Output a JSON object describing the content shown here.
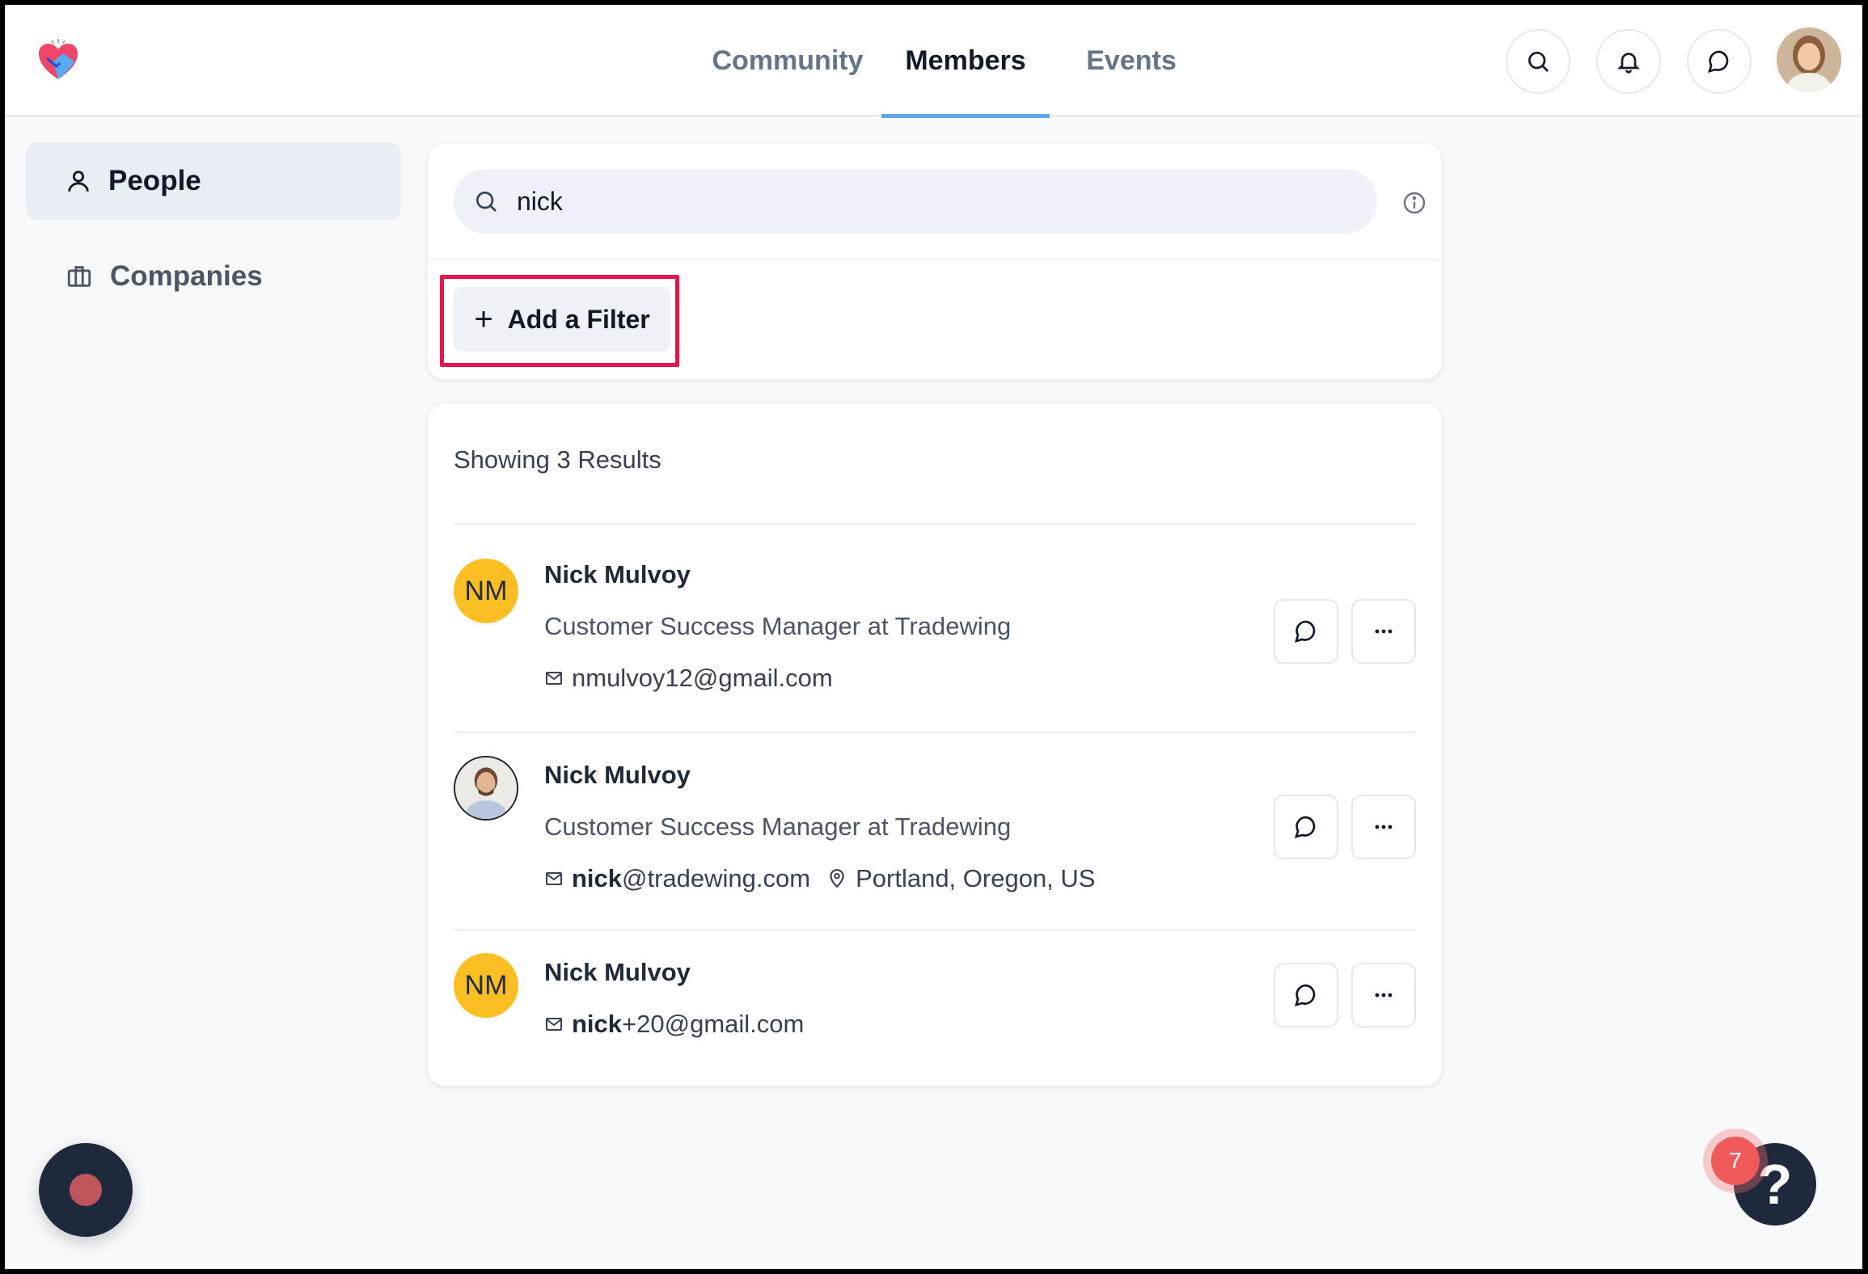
{
  "header": {
    "tabs": [
      {
        "label": "Community"
      },
      {
        "label": "Members"
      },
      {
        "label": "Events"
      }
    ]
  },
  "sidebar": {
    "items": [
      {
        "label": "People"
      },
      {
        "label": "Companies"
      }
    ]
  },
  "search": {
    "value": "nick",
    "add_filter_label": "Add a Filter"
  },
  "results": {
    "count_label": "Showing 3 Results",
    "items": [
      {
        "initials": "NM",
        "name": "Nick Mulvoy",
        "title": "Customer Success Manager at Tradewing",
        "email": "nmulvoy12@gmail.com"
      },
      {
        "name": "Nick Mulvoy",
        "title": "Customer Success Manager at Tradewing",
        "email_match": "nick",
        "email_rest": "@tradewing.com",
        "location": "Portland, Oregon, US"
      },
      {
        "initials": "NM",
        "name": "Nick Mulvoy",
        "email_match": "nick",
        "email_rest": "+20@gmail.com"
      }
    ]
  },
  "help": {
    "badge_count": "7",
    "icon_label": "?"
  },
  "colors": {
    "accent": "#60a5e8",
    "highlight_outline": "#e6154e",
    "avatar_bg": "#fbbf24",
    "badge": "#f05a5a"
  }
}
